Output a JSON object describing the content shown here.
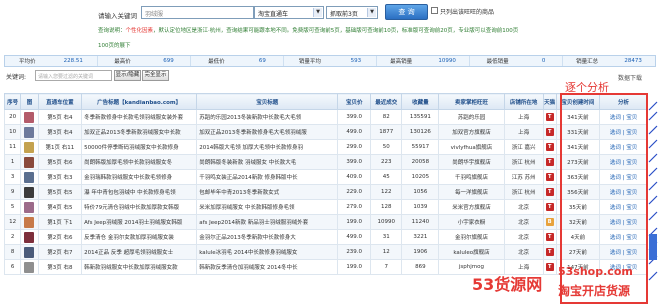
{
  "search": {
    "label": "请输入关键词",
    "keyword": "羽绒服",
    "mode_select": "淘宝直通车",
    "page_select": "抓取前3页",
    "query_label": "查 询",
    "only_label": "只列出该旺旺的商品"
  },
  "notice": {
    "prefix": "查询说明：",
    "red_part": "个性化因素",
    "text": "，默认定位地区是浙江·杭州，查询结果可能跟本地不同。免费版可查询前5页，基础版可查询前10页，标准版可查询前20页，专业版可以查询前100页",
    "line2": "100页的展下"
  },
  "stats": [
    {
      "label": "平均价",
      "value": "228.51"
    },
    {
      "label": "最高价",
      "value": "699"
    },
    {
      "label": "最低价",
      "value": "69"
    },
    {
      "label": "销量平均",
      "value": "593"
    },
    {
      "label": "最高销量",
      "value": "10990"
    },
    {
      "label": "最低销量",
      "value": "0"
    },
    {
      "label": "销量汇总",
      "value": "28473"
    }
  ],
  "filter": {
    "label": "关键词:",
    "placeholder": "请输入您要过滤的关键词",
    "toggle_label": "显示/隐藏",
    "all_label": "完全显示",
    "download_label": "数据下载"
  },
  "overlay_title": "逐个分析",
  "table": {
    "headers": [
      "序号",
      "图",
      "直通车位置",
      "广告标题",
      "宝贝标题",
      "宝贝价",
      "最近成交",
      "收藏量",
      "卖家掌柜旺旺",
      "店铺所在地",
      "天猫",
      "宝贝创建时间",
      "分析"
    ],
    "ad_title_header": "广告标题【kandianbao.com】",
    "rows": [
      {
        "no": "20",
        "pos": "第5页 右4",
        "ad": "冬季新款修身中长款毛领羽绒服女装外套",
        "title": "苏蹈的乐园2013冬装新款中长款毛大毛领",
        "price": "399.0",
        "deal": "82",
        "fav": "135591",
        "seller": "苏蹈的乐园",
        "loc": "上海",
        "tmall": "T",
        "age": "341天前",
        "analysis": "选词 | 宝贝",
        "thumb": "#b35b6a"
      },
      {
        "no": "10",
        "pos": "第3页 右4",
        "ad": "加双正品2013冬季新款羽绒服女中长款",
        "title": "加双正品2013冬季新款修身毛大毛领羽绒服",
        "price": "499.0",
        "deal": "1877",
        "fav": "130126",
        "seller": "加双官方旗舰店",
        "loc": "上海",
        "tmall": "T",
        "age": "331天前",
        "analysis": "选词 | 宝贝",
        "thumb": "#6d7a9c"
      },
      {
        "no": "11",
        "pos": "第1页 右11",
        "ad": "50000件停季断码羽绒服女中长款修身",
        "title": "2014韩版大毛领 加厚大毛领中长款修身羽",
        "price": "299.0",
        "deal": "50",
        "fav": "55917",
        "seller": "vivlyfhua旗舰店",
        "loc": "浙江 嘉兴",
        "tmall": "T",
        "age": "341天前",
        "analysis": "选词 | 宝贝",
        "thumb": "#c4a24f"
      },
      {
        "no": "1",
        "pos": "第5页 右6",
        "ad": "尚朗韩版加厚毛领中长款羽绒服女冬",
        "title": "尚朗韩版冬装新款 羽绒服女 中长款大毛",
        "price": "399.0",
        "deal": "223",
        "fav": "20058",
        "seller": "尚朗华宇旗舰店",
        "loc": "浙江 杭州",
        "tmall": "T",
        "age": "273天前",
        "analysis": "选词 | 宝贝",
        "thumb": "#8a4a3c"
      },
      {
        "no": "3",
        "pos": "第3页 右3",
        "ad": "金羽瑞韩款羽绒服女中长款毛领修身",
        "title": "千羽鸣女装正品2014新款 修身韩版中长",
        "price": "409.0",
        "deal": "45",
        "fav": "10205",
        "seller": "千羽鸣旗舰店",
        "loc": "江苏 苏州",
        "tmall": "T",
        "age": "363天前",
        "analysis": "选词 | 宝贝",
        "thumb": "#5b6f8f"
      },
      {
        "no": "9",
        "pos": "第5页 右5",
        "ad": "瀑 年中青包包羽绒中 中长款修身毛领",
        "title": "包邮毕年中青2013冬季新款女式",
        "price": "229.0",
        "deal": "122",
        "fav": "1056",
        "seller": "每一洋旗舰店",
        "loc": "浙江 杭州",
        "tmall": "T",
        "age": "356天前",
        "analysis": "选词 | 宝贝",
        "thumb": "#3c3c3c"
      },
      {
        "no": "5",
        "pos": "第4页 右5",
        "ad": "特价79元清仓羽绒中长款加厚款女韩版",
        "title": "米米加厚羽绒服女 中长款韩版修身毛领",
        "price": "279.0",
        "deal": "128",
        "fav": "1039",
        "seller": "米米官方旗舰店",
        "loc": "北京",
        "tmall": "T",
        "age": "35天前",
        "analysis": "选词 | 宝贝",
        "thumb": "#9c6b8a"
      },
      {
        "no": "12",
        "pos": "第1页 下1",
        "ad": "Afs Jeep羽绒服 2014羽士羽绒服女韩版",
        "title": "afs Jeep2014新款 新品羽士羽绒服羽绒外套",
        "price": "199.0",
        "deal": "10990",
        "fav": "11240",
        "seller": "小宇家衣橱",
        "loc": "北京",
        "tmall": "B",
        "age": "32天前",
        "analysis": "选词 | 宝贝",
        "thumb": "#c77a4a"
      },
      {
        "no": "2",
        "pos": "第2页 右6",
        "ad": "反季清仓 金羽尔女款加厚羽绒服女装",
        "title": "金羽尔正品2013冬季新款中长款修身大",
        "price": "499.0",
        "deal": "31",
        "fav": "3221",
        "seller": "金羽尔旗舰店",
        "loc": "北京",
        "tmall": "T",
        "age": "4天前",
        "analysis": "选词 | 宝贝",
        "thumb": "#7d2f3c"
      },
      {
        "no": "8",
        "pos": "第2页 右7",
        "ad": "2014正品 反季 超厚毛领羽绒服女士",
        "title": "kalule冰羽毛 2014中长款修身羽绒服女",
        "price": "239.0",
        "deal": "12",
        "fav": "1906",
        "seller": "kaluleo旗舰店",
        "loc": "北京",
        "tmall": "T",
        "age": "27天前",
        "analysis": "选词 | 宝贝",
        "thumb": "#4a5b7a"
      },
      {
        "no": "6",
        "pos": "第3页 右8",
        "ad": "韩新款羽绒服女中长款加厚羽绒服女款",
        "title": "韩新款反季清仓加羽绒服女 2014冬中长",
        "price": "199.0",
        "deal": "7",
        "fav": "869",
        "seller": "jsphjmog",
        "loc": "上海",
        "tmall": "T",
        "age": "147天前",
        "analysis": "选词 | 宝贝",
        "thumb": "#8f8f8f"
      }
    ]
  },
  "watermark": {
    "main": "53货源网",
    "site": "53shop.com",
    "slogan": "淘宝开店货源"
  },
  "colors": {
    "accent": "#1a5fb4",
    "overlay_red": "#e53935",
    "notice_green": "#2e7d32"
  }
}
